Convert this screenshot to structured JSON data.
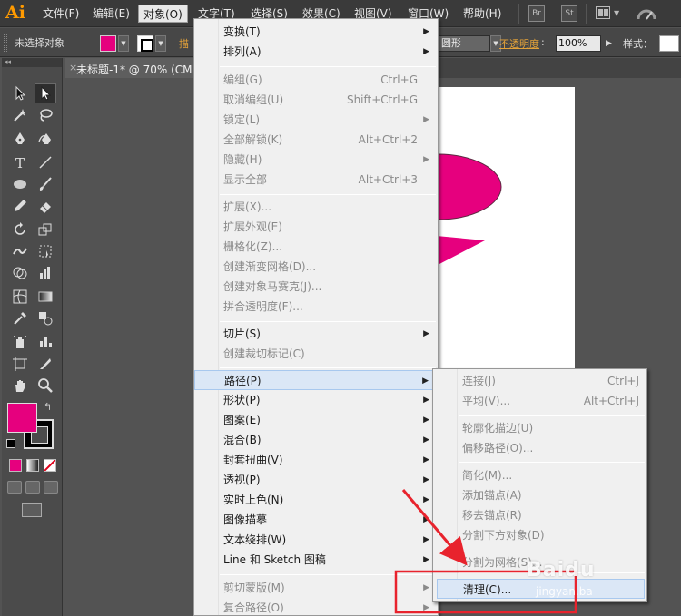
{
  "app": {
    "logo": "Ai"
  },
  "menubar": {
    "items": [
      "文件(F)",
      "编辑(E)",
      "对象(O)",
      "文字(T)",
      "选择(S)",
      "效果(C)",
      "视图(V)",
      "窗口(W)",
      "帮助(H)"
    ],
    "active": "对象(O)",
    "buttons": {
      "bridge": "Br",
      "stock": "St"
    }
  },
  "controlbar": {
    "selection": "未选择对象",
    "stroke_label_partial": "描",
    "shape_value": "圆形",
    "opacity_label": "不透明度",
    "opacity_value": "100%",
    "style_label": "样式：",
    "colors": {
      "fill": "#e6007e",
      "label": "#e3a239"
    }
  },
  "document": {
    "title": "未标题-1* @ 70% (CM"
  },
  "object_menu": {
    "items": [
      {
        "label": "变换(T)",
        "shortcut": "",
        "submenu": true,
        "disabled": false
      },
      {
        "label": "排列(A)",
        "shortcut": "",
        "submenu": true,
        "disabled": false
      },
      {
        "label": "编组(G)",
        "shortcut": "Ctrl+G",
        "submenu": false,
        "disabled": true
      },
      {
        "label": "取消编组(U)",
        "shortcut": "Shift+Ctrl+G",
        "submenu": false,
        "disabled": true
      },
      {
        "label": "锁定(L)",
        "shortcut": "",
        "submenu": true,
        "disabled": true
      },
      {
        "label": "全部解锁(K)",
        "shortcut": "Alt+Ctrl+2",
        "submenu": false,
        "disabled": true
      },
      {
        "label": "隐藏(H)",
        "shortcut": "",
        "submenu": true,
        "disabled": true
      },
      {
        "label": "显示全部",
        "shortcut": "Alt+Ctrl+3",
        "submenu": false,
        "disabled": true
      },
      {
        "label": "扩展(X)...",
        "shortcut": "",
        "submenu": false,
        "disabled": true
      },
      {
        "label": "扩展外观(E)",
        "shortcut": "",
        "submenu": false,
        "disabled": true
      },
      {
        "label": "栅格化(Z)...",
        "shortcut": "",
        "submenu": false,
        "disabled": true
      },
      {
        "label": "创建渐变网格(D)...",
        "shortcut": "",
        "submenu": false,
        "disabled": true
      },
      {
        "label": "创建对象马赛克(J)...",
        "shortcut": "",
        "submenu": false,
        "disabled": true
      },
      {
        "label": "拼合透明度(F)...",
        "shortcut": "",
        "submenu": false,
        "disabled": true
      },
      {
        "label": "切片(S)",
        "shortcut": "",
        "submenu": true,
        "disabled": false
      },
      {
        "label": "创建裁切标记(C)",
        "shortcut": "",
        "submenu": false,
        "disabled": true
      },
      {
        "label": "路径(P)",
        "shortcut": "",
        "submenu": true,
        "disabled": false
      },
      {
        "label": "形状(P)",
        "shortcut": "",
        "submenu": true,
        "disabled": false
      },
      {
        "label": "图案(E)",
        "shortcut": "",
        "submenu": true,
        "disabled": false
      },
      {
        "label": "混合(B)",
        "shortcut": "",
        "submenu": true,
        "disabled": false
      },
      {
        "label": "封套扭曲(V)",
        "shortcut": "",
        "submenu": true,
        "disabled": false
      },
      {
        "label": "透视(P)",
        "shortcut": "",
        "submenu": true,
        "disabled": false
      },
      {
        "label": "实时上色(N)",
        "shortcut": "",
        "submenu": true,
        "disabled": false
      },
      {
        "label": "图像描摹",
        "shortcut": "",
        "submenu": true,
        "disabled": false
      },
      {
        "label": "文本绕排(W)",
        "shortcut": "",
        "submenu": true,
        "disabled": false
      },
      {
        "label": "Line 和 Sketch 图稿",
        "shortcut": "",
        "submenu": true,
        "disabled": false
      },
      {
        "label": "剪切蒙版(M)",
        "shortcut": "",
        "submenu": true,
        "disabled": true
      },
      {
        "label": "复合路径(O)",
        "shortcut": "",
        "submenu": true,
        "disabled": true
      }
    ]
  },
  "path_submenu": {
    "items": [
      {
        "label": "连接(J)",
        "shortcut": "Ctrl+J",
        "disabled": true
      },
      {
        "label": "平均(V)...",
        "shortcut": "Alt+Ctrl+J",
        "disabled": true
      },
      {
        "label": "轮廓化描边(U)",
        "shortcut": "",
        "disabled": true
      },
      {
        "label": "偏移路径(O)...",
        "shortcut": "",
        "disabled": true
      },
      {
        "label": "简化(M)...",
        "shortcut": "",
        "disabled": true
      },
      {
        "label": "添加锚点(A)",
        "shortcut": "",
        "disabled": true
      },
      {
        "label": "移去锚点(R)",
        "shortcut": "",
        "disabled": true
      },
      {
        "label": "分割下方对象(D)",
        "shortcut": "",
        "disabled": true
      },
      {
        "label": "分割为网格(S)...",
        "shortcut": "",
        "disabled": true
      },
      {
        "label": "清理(C)...",
        "shortcut": "",
        "disabled": false
      }
    ]
  },
  "watermark": {
    "text": "Baidu",
    "sub": "jingyan.ba"
  },
  "annotation_color": "#e8232d",
  "artwork_color": "#e6007e"
}
